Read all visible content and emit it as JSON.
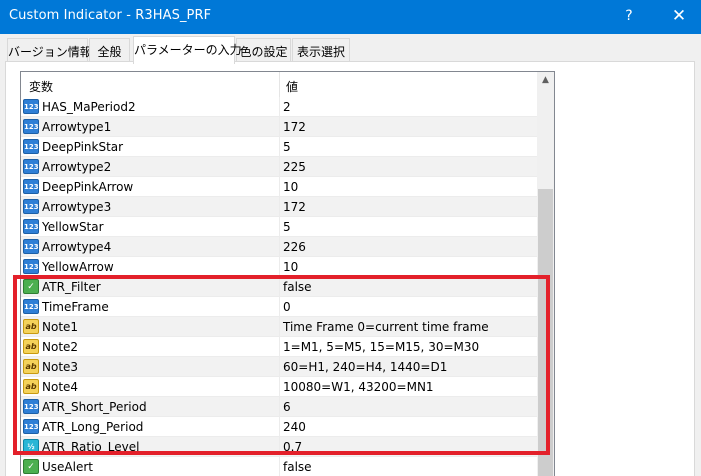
{
  "window": {
    "title": "Custom Indicator - R3HAS_PRF",
    "help_label": "?",
    "close_label": "✕"
  },
  "tabs": [
    {
      "label": "バージョン情報",
      "active": false
    },
    {
      "label": "全般",
      "active": false
    },
    {
      "label": "パラメーターの入力",
      "active": true
    },
    {
      "label": "色の設定",
      "active": false
    },
    {
      "label": "表示選択",
      "active": false
    }
  ],
  "grid": {
    "col_variable": "変数",
    "col_value": "値",
    "rows": [
      {
        "type": "int",
        "type_icon": "123",
        "name": "HAS_MaPeriod2",
        "value": "2"
      },
      {
        "type": "int",
        "type_icon": "123",
        "name": "Arrowtype1",
        "value": "172"
      },
      {
        "type": "int",
        "type_icon": "123",
        "name": "DeepPinkStar",
        "value": "5"
      },
      {
        "type": "int",
        "type_icon": "123",
        "name": "Arrowtype2",
        "value": "225"
      },
      {
        "type": "int",
        "type_icon": "123",
        "name": "DeepPinkArrow",
        "value": "10"
      },
      {
        "type": "int",
        "type_icon": "123",
        "name": "Arrowtype3",
        "value": "172"
      },
      {
        "type": "int",
        "type_icon": "123",
        "name": "YellowStar",
        "value": "5"
      },
      {
        "type": "int",
        "type_icon": "123",
        "name": "Arrowtype4",
        "value": "226"
      },
      {
        "type": "int",
        "type_icon": "123",
        "name": "YellowArrow",
        "value": "10"
      },
      {
        "type": "bool",
        "type_icon": "✓",
        "name": "ATR_Filter",
        "value": "false"
      },
      {
        "type": "int",
        "type_icon": "123",
        "name": "TimeFrame",
        "value": "0"
      },
      {
        "type": "str",
        "type_icon": "ab",
        "name": "Note1",
        "value": "Time Frame 0=current time frame"
      },
      {
        "type": "str",
        "type_icon": "ab",
        "name": "Note2",
        "value": "1=M1, 5=M5, 15=M15, 30=M30"
      },
      {
        "type": "str",
        "type_icon": "ab",
        "name": "Note3",
        "value": "60=H1, 240=H4, 1440=D1"
      },
      {
        "type": "str",
        "type_icon": "ab",
        "name": "Note4",
        "value": "10080=W1, 43200=MN1"
      },
      {
        "type": "int",
        "type_icon": "123",
        "name": "ATR_Short_Period",
        "value": "6"
      },
      {
        "type": "int",
        "type_icon": "123",
        "name": "ATR_Long_Period",
        "value": "240"
      },
      {
        "type": "dbl",
        "type_icon": "½",
        "name": "ATR_Ratio_Level",
        "value": "0.7"
      },
      {
        "type": "bool",
        "type_icon": "✓",
        "name": "UseAlert",
        "value": "false"
      }
    ]
  },
  "colors": {
    "titlebar": "#0078d7",
    "highlight_box": "#e3202a"
  },
  "scrollbar": {
    "up_arrow": "▲"
  }
}
